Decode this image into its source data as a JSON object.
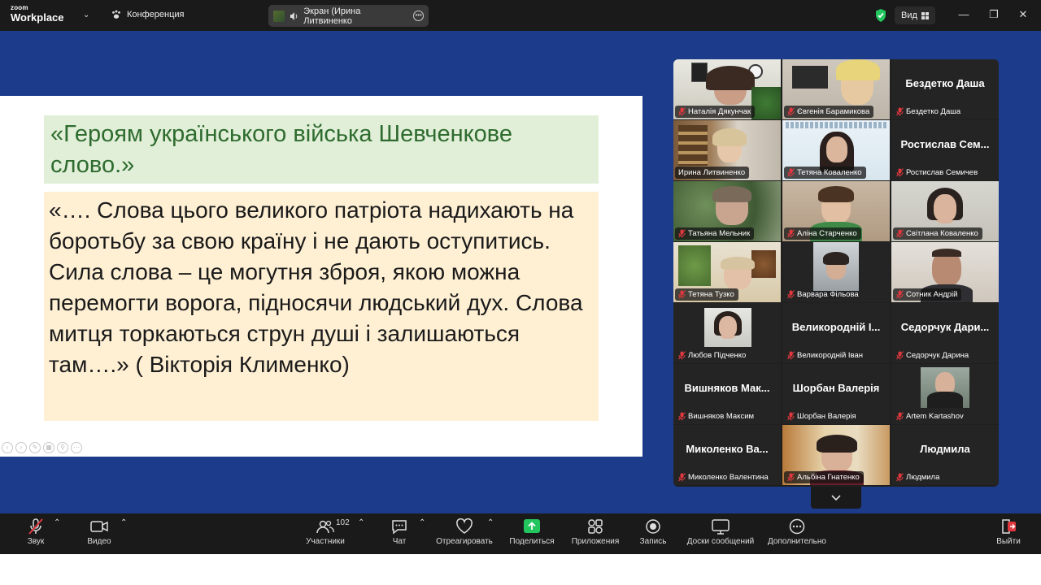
{
  "titlebar": {
    "logo_top": "zoom",
    "logo_bottom": "Workplace",
    "meeting_name": "Конференция",
    "screen_share_label": "Экран (Ирина Литвиненко",
    "view_label": "Вид"
  },
  "slide": {
    "title": "«Героям українського війська Шевченкове слово.»",
    "quote": "«…. Слова цього великого патріота надихають на боротьбу за свою країну і не дають оступитись. Сила слова – це могутня зброя, якою можна перемогти ворога, підносячи людський дух. Слова митця торкаються струн душі і залишаються там….» ( Вікторія Клименко)"
  },
  "gallery": {
    "tiles": [
      {
        "name": "Наталія Дякунчак",
        "big": ""
      },
      {
        "name": "Євгенія Барамикова",
        "big": ""
      },
      {
        "name": "Бездетко Даша",
        "big": "Бездетко Даша"
      },
      {
        "name": "Ирина Литвиненко",
        "big": ""
      },
      {
        "name": "Тетяна  Коваленко",
        "big": ""
      },
      {
        "name": "Ростислав Семичев",
        "big": "Ростислав  Сем..."
      },
      {
        "name": "Татьяна Мельник",
        "big": ""
      },
      {
        "name": "Аліна Старченко",
        "big": ""
      },
      {
        "name": "Світлана Коваленко",
        "big": ""
      },
      {
        "name": "Тетяна Тузко",
        "big": ""
      },
      {
        "name": "Варвара Фільова",
        "big": ""
      },
      {
        "name": "Сотник Андрій",
        "big": ""
      },
      {
        "name": "Любов Підченко",
        "big": ""
      },
      {
        "name": "Великородній Іван",
        "big": "Великородній І..."
      },
      {
        "name": "Седорчук Дарина",
        "big": "Седорчук  Дари..."
      },
      {
        "name": "Вишняков Максим",
        "big": "Вишняков  Мак..."
      },
      {
        "name": "Шорбан Валерія",
        "big": "Шорбан Валерія"
      },
      {
        "name": "Artem Kartashov",
        "big": ""
      },
      {
        "name": "Миколенко Валентина",
        "big": "Миколенко  Ва..."
      },
      {
        "name": "Альбіна Гнатенко",
        "big": ""
      },
      {
        "name": "Людмила",
        "big": "Людмила"
      }
    ]
  },
  "toolbar": {
    "audio": "Звук",
    "video": "Видео",
    "participants": "Участники",
    "participants_count": "102",
    "chat": "Чат",
    "react": "Отреагировать",
    "share": "Поделиться",
    "apps": "Приложения",
    "record": "Запись",
    "whiteboards": "Доски сообщений",
    "more": "Дополнительно",
    "leave": "Выйти"
  },
  "colors": {
    "stage_bg": "#1c3b8a",
    "title_bg": "#e1efd8",
    "title_text": "#2e6b2e",
    "quote_bg": "#fff0d4",
    "active_speaker": "#31c36c",
    "share_green": "#23c55e",
    "leave_red": "#e0383e"
  }
}
